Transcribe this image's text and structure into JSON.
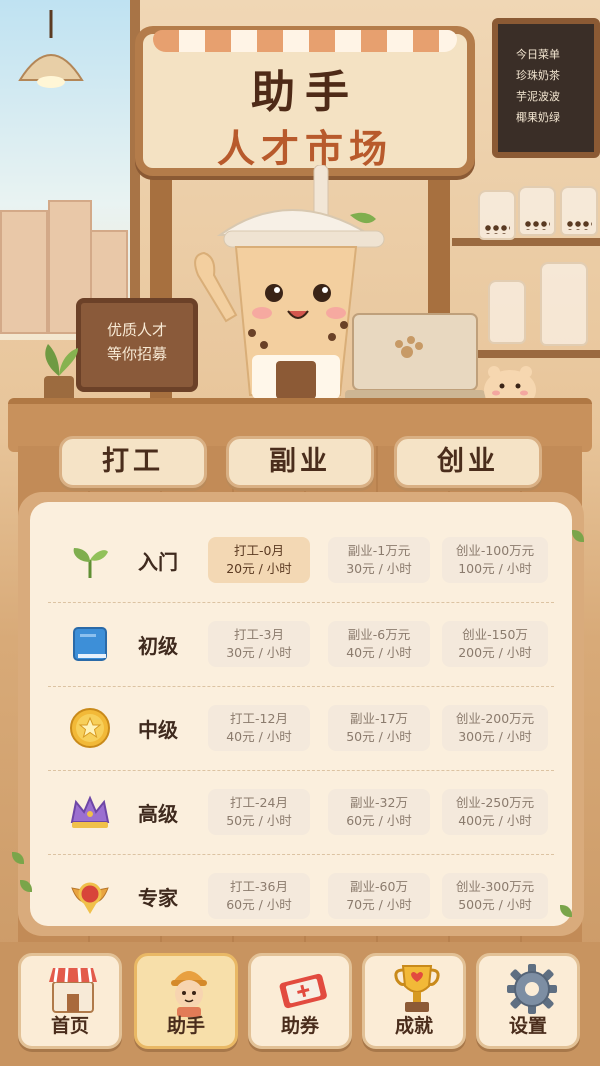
{
  "sign": {
    "line1": "助手",
    "line2": "人才市场"
  },
  "menu_board": {
    "items": [
      "今日菜单",
      "珍珠奶茶",
      "芋泥波波",
      "椰果奶绿"
    ]
  },
  "small_sign": {
    "line1": "优质人才",
    "line2": "等你招募"
  },
  "tabs": [
    {
      "label": "打工"
    },
    {
      "label": "副业"
    },
    {
      "label": "创业"
    }
  ],
  "levels": [
    {
      "name": "入门",
      "icon": "sprout-icon",
      "cells": [
        {
          "l1": "打工-0月",
          "l2": "20元 / 小时",
          "active": true
        },
        {
          "l1": "副业-1万元",
          "l2": "30元 / 小时"
        },
        {
          "l1": "创业-100万元",
          "l2": "100元 / 小时"
        }
      ]
    },
    {
      "name": "初级",
      "icon": "book-icon",
      "cells": [
        {
          "l1": "打工-3月",
          "l2": "30元 / 小时"
        },
        {
          "l1": "副业-6万元",
          "l2": "40元 / 小时"
        },
        {
          "l1": "创业-150万",
          "l2": "200元 / 小时"
        }
      ]
    },
    {
      "name": "中级",
      "icon": "star-coin-icon",
      "cells": [
        {
          "l1": "打工-12月",
          "l2": "40元 / 小时"
        },
        {
          "l1": "副业-17万",
          "l2": "50元 / 小时"
        },
        {
          "l1": "创业-200万元",
          "l2": "300元 / 小时"
        }
      ]
    },
    {
      "name": "高级",
      "icon": "crown-icon",
      "cells": [
        {
          "l1": "打工-24月",
          "l2": "50元 / 小时"
        },
        {
          "l1": "副业-32万",
          "l2": "60元 / 小时"
        },
        {
          "l1": "创业-250万元",
          "l2": "400元 / 小时"
        }
      ]
    },
    {
      "name": "专家",
      "icon": "winged-medal-icon",
      "cells": [
        {
          "l1": "打工-36月",
          "l2": "60元 / 小时"
        },
        {
          "l1": "副业-60万",
          "l2": "70元 / 小时"
        },
        {
          "l1": "创业-300万元",
          "l2": "500元 / 小时"
        }
      ]
    }
  ],
  "nav": [
    {
      "label": "首页",
      "icon": "shop-icon"
    },
    {
      "label": "助手",
      "icon": "assistant-avatar-icon",
      "active": true
    },
    {
      "label": "助券",
      "icon": "ticket-icon"
    },
    {
      "label": "成就",
      "icon": "trophy-icon"
    },
    {
      "label": "设置",
      "icon": "gear-icon"
    }
  ],
  "colors": {
    "accent": "#f3d8b4",
    "text_dark": "#3f2a1e",
    "wood": "#c8915c"
  }
}
